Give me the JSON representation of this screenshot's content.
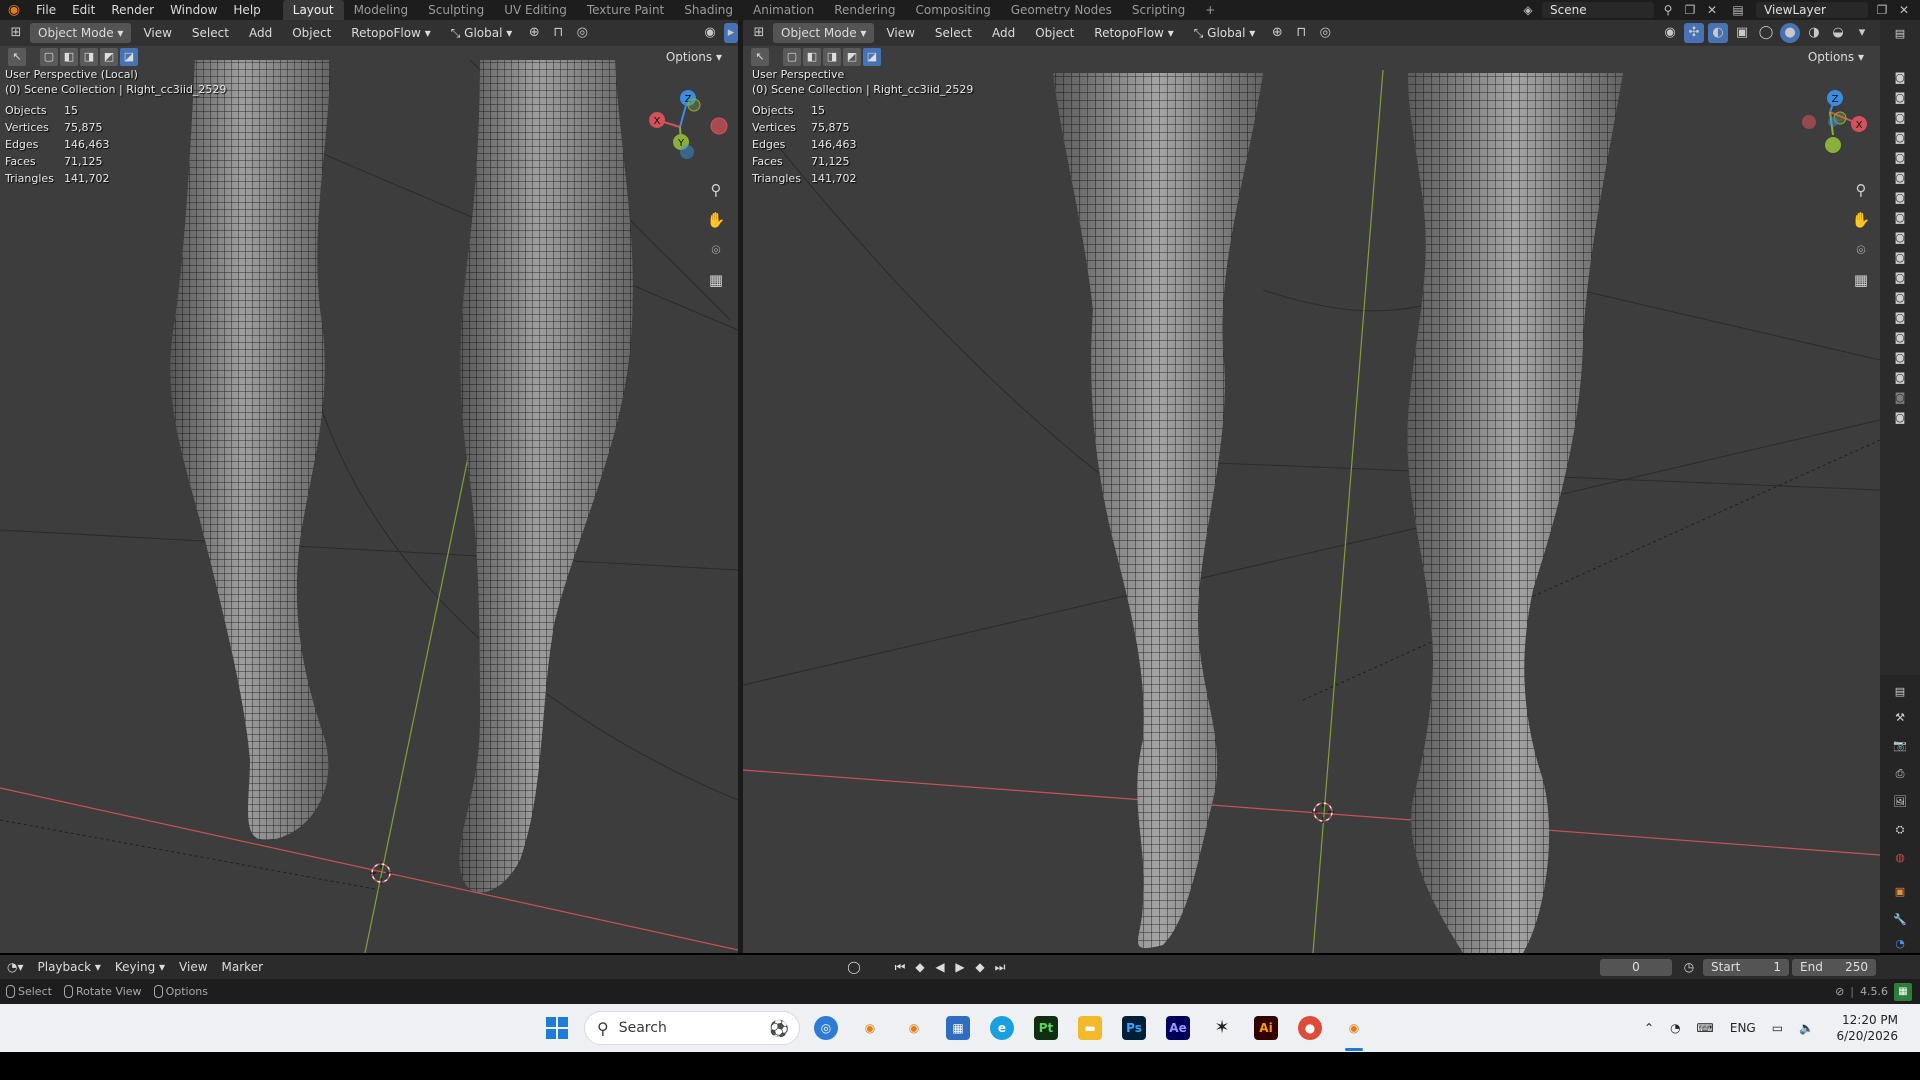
{
  "topbar": {
    "menus": [
      "File",
      "Edit",
      "Render",
      "Window",
      "Help"
    ],
    "workspaces": [
      "Layout",
      "Modeling",
      "Sculpting",
      "UV Editing",
      "Texture Paint",
      "Shading",
      "Animation",
      "Rendering",
      "Compositing",
      "Geometry Nodes",
      "Scripting"
    ],
    "active_workspace": "Layout",
    "add_tab": "+",
    "scene": "Scene",
    "view_layer": "ViewLayer"
  },
  "left_viewport": {
    "mode": "Object Mode",
    "menus": [
      "View",
      "Select",
      "Add",
      "Object"
    ],
    "addon": "RetopoFlow",
    "transform": "Global",
    "options": "Options",
    "perspective": "User Perspective (Local)",
    "collection": "(0) Scene Collection | Right_cc3iid_2529",
    "stats": [
      {
        "k": "Objects",
        "v": "15"
      },
      {
        "k": "Vertices",
        "v": "75,875"
      },
      {
        "k": "Edges",
        "v": "146,463"
      },
      {
        "k": "Faces",
        "v": "71,125"
      },
      {
        "k": "Triangles",
        "v": "141,702"
      }
    ],
    "gizmo": {
      "x": "X",
      "y": "Y",
      "z": "Z"
    }
  },
  "right_viewport": {
    "mode": "Object Mode",
    "menus": [
      "View",
      "Select",
      "Add",
      "Object"
    ],
    "addon": "RetopoFlow",
    "transform": "Global",
    "options": "Options",
    "perspective": "User Perspective",
    "collection": "(0) Scene Collection | Right_cc3iid_2529",
    "stats": [
      {
        "k": "Objects",
        "v": "15"
      },
      {
        "k": "Vertices",
        "v": "75,875"
      },
      {
        "k": "Edges",
        "v": "146,463"
      },
      {
        "k": "Faces",
        "v": "71,125"
      },
      {
        "k": "Triangles",
        "v": "141,702"
      }
    ],
    "gizmo": {
      "x": "X",
      "y": "Y",
      "z": "Z"
    }
  },
  "timeline": {
    "menus": [
      "Playback",
      "Keying",
      "View",
      "Marker"
    ],
    "current_frame": "0",
    "start_label": "Start",
    "start": "1",
    "end_label": "End",
    "end": "250"
  },
  "statusbar": {
    "select": "Select",
    "rotate": "Rotate View",
    "options": "Options",
    "version": "4.5.6"
  },
  "taskbar": {
    "search_placeholder": "Search",
    "language": "ENG",
    "time": "12:20 PM",
    "date": "6/20/2026",
    "apps": [
      "Pt",
      "Ps",
      "Ae",
      "Ai"
    ]
  },
  "colors": {
    "viewport_bg": "#3d3d3d",
    "x_axis": "#d4505a",
    "y_axis": "#8ab03a",
    "z_axis": "#3b8de0",
    "active_blue": "#4772b3"
  }
}
